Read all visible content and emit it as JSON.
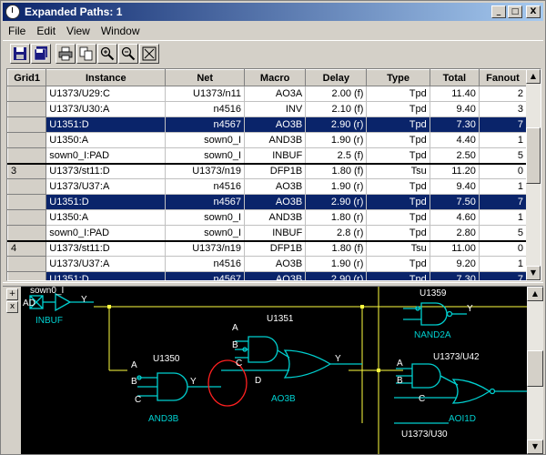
{
  "window": {
    "title": "Expanded Paths: 1",
    "min_label": "_",
    "max_label": "□",
    "close_label": "X"
  },
  "menu": [
    "File",
    "Edit",
    "View",
    "Window"
  ],
  "toolbar_icons": [
    "save-icon",
    "save-all-icon",
    "print-icon",
    "copy-icon",
    "zoom-in-icon",
    "zoom-out-icon",
    "zoom-fit-icon"
  ],
  "side_tools": [
    "+",
    "x"
  ],
  "table": {
    "columns": [
      "Grid1",
      "Instance",
      "Net",
      "Macro",
      "Delay",
      "Type",
      "Total",
      "Fanout"
    ],
    "rows": [
      {
        "grid": "",
        "instance": "U1373/U29:C",
        "net": "U1373/n11",
        "macro": "AO3A",
        "delay": "2.00 (f)",
        "type": "Tpd",
        "total": "11.40",
        "fanout": "2",
        "selected": false,
        "group_start": false
      },
      {
        "grid": "",
        "instance": "U1373/U30:A",
        "net": "n4516",
        "macro": "INV",
        "delay": "2.10 (f)",
        "type": "Tpd",
        "total": "9.40",
        "fanout": "3",
        "selected": false,
        "group_start": false
      },
      {
        "grid": "",
        "instance": "U1351:D",
        "net": "n4567",
        "macro": "AO3B",
        "delay": "2.90 (r)",
        "type": "Tpd",
        "total": "7.30",
        "fanout": "7",
        "selected": true,
        "group_start": false
      },
      {
        "grid": "",
        "instance": "U1350:A",
        "net": "sown0_I",
        "macro": "AND3B",
        "delay": "1.90 (r)",
        "type": "Tpd",
        "total": "4.40",
        "fanout": "1",
        "selected": false,
        "group_start": false
      },
      {
        "grid": "",
        "instance": "sown0_I:PAD",
        "net": "sown0_I",
        "macro": "INBUF",
        "delay": "2.5 (f)",
        "type": "Tpd",
        "total": "2.50",
        "fanout": "5",
        "selected": false,
        "group_start": false
      },
      {
        "grid": "3",
        "instance": "U1373/st11:D",
        "net": "U1373/n19",
        "macro": "DFP1B",
        "delay": "1.80 (f)",
        "type": "Tsu",
        "total": "11.20",
        "fanout": "0",
        "selected": false,
        "group_start": true
      },
      {
        "grid": "",
        "instance": "U1373/U37:A",
        "net": "n4516",
        "macro": "AO3B",
        "delay": "1.90 (r)",
        "type": "Tpd",
        "total": "9.40",
        "fanout": "1",
        "selected": false,
        "group_start": false
      },
      {
        "grid": "",
        "instance": "U1351:D",
        "net": "n4567",
        "macro": "AO3B",
        "delay": "2.90 (r)",
        "type": "Tpd",
        "total": "7.50",
        "fanout": "7",
        "selected": true,
        "group_start": false
      },
      {
        "grid": "",
        "instance": "U1350:A",
        "net": "sown0_I",
        "macro": "AND3B",
        "delay": "1.80 (r)",
        "type": "Tpd",
        "total": "4.60",
        "fanout": "1",
        "selected": false,
        "group_start": false
      },
      {
        "grid": "",
        "instance": "sown0_I:PAD",
        "net": "sown0_I",
        "macro": "INBUF",
        "delay": "2.8 (r)",
        "type": "Tpd",
        "total": "2.80",
        "fanout": "5",
        "selected": false,
        "group_start": false
      },
      {
        "grid": "4",
        "instance": "U1373/st11:D",
        "net": "U1373/n19",
        "macro": "DFP1B",
        "delay": "1.80 (f)",
        "type": "Tsu",
        "total": "11.00",
        "fanout": "0",
        "selected": false,
        "group_start": true
      },
      {
        "grid": "",
        "instance": "U1373/U37:A",
        "net": "n4516",
        "macro": "AO3B",
        "delay": "1.90 (r)",
        "type": "Tpd",
        "total": "9.20",
        "fanout": "1",
        "selected": false,
        "group_start": false
      },
      {
        "grid": "",
        "instance": "U1351:D",
        "net": "n4567",
        "macro": "AO3B",
        "delay": "2.90 (r)",
        "type": "Tpd",
        "total": "7.30",
        "fanout": "7",
        "selected": true,
        "group_start": false
      }
    ]
  },
  "schematic": {
    "labels": {
      "sown": "sown0_I",
      "inbuf": "INBUF",
      "pad": "AD",
      "y": "Y",
      "u1350": "U1350",
      "and3b": "AND3B",
      "u1351": "U1351",
      "ao3b": "AO3B",
      "u1359": "U1359",
      "nand2a": "NAND2A",
      "u1373_u42": "U1373/U42",
      "aoi1d": "AOI1D",
      "u1373_u30": "U1373/U30",
      "a": "A",
      "b": "B",
      "c": "C",
      "d": "D"
    },
    "colors": {
      "gate": "#00d0d0",
      "wire": "#ffff40",
      "highlight": "#ff2020",
      "text": "#ffffff",
      "gate_text": "#00d0d0"
    }
  }
}
